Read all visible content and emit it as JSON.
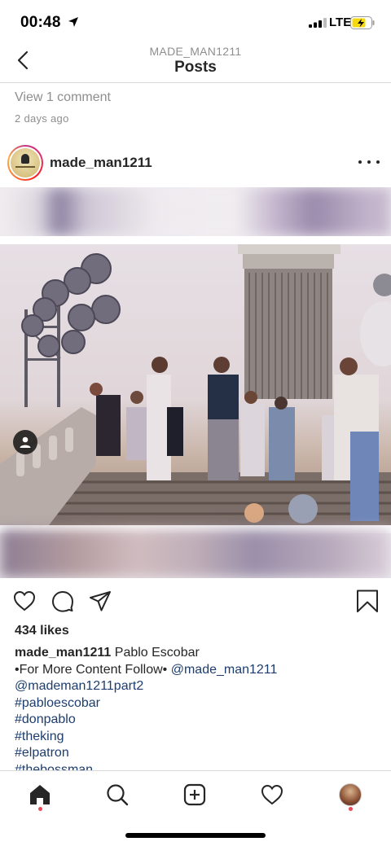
{
  "status_bar": {
    "time": "00:48",
    "network": "LTE"
  },
  "nav": {
    "subtitle": "MADE_MAN1211",
    "title": "Posts"
  },
  "prev_post": {
    "view_comments": "View 1 comment",
    "posted_ago": "2 days ago"
  },
  "post": {
    "username": "made_man1211",
    "likes": "434 likes",
    "caption": {
      "username": "made_man1211",
      "text": "Pablo Escobar",
      "follow_prefix": "•For More Content Follow•",
      "mention1": "@made_man1211",
      "mention2": "@mademan1211part2",
      "hashtags": [
        "#pabloescobar",
        "#donpablo",
        "#theking",
        "#elpatron",
        "#thebossman"
      ]
    }
  },
  "icons": {
    "like": "heart-icon",
    "comment": "comment-icon",
    "share": "send-icon",
    "save": "bookmark-icon"
  },
  "colors": {
    "link": "#1d3d6e",
    "notification_dot": "#ed4956",
    "secondary_text": "#8e8e8e"
  }
}
